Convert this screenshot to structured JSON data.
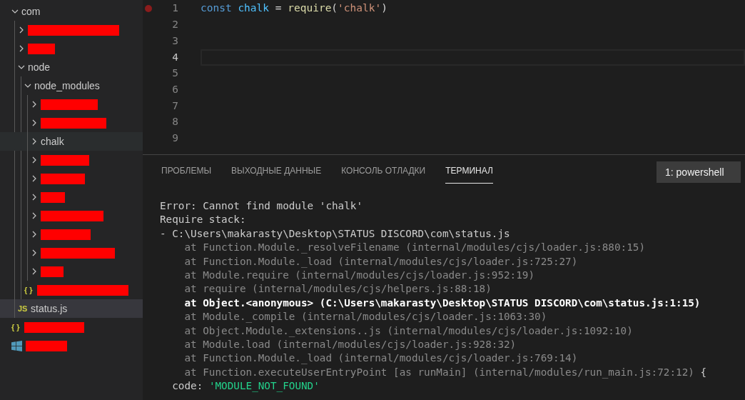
{
  "explorer": {
    "items": [
      {
        "kind": "folder",
        "label": "com",
        "expanded": true,
        "children": [
          {
            "kind": "folder",
            "redacted": true,
            "expanded": false
          },
          {
            "kind": "folder",
            "redacted": true,
            "expanded": false
          },
          {
            "kind": "folder",
            "label": "node",
            "expanded": true,
            "children": [
              {
                "kind": "folder",
                "label": "node_modules",
                "expanded": true,
                "children": [
                  {
                    "kind": "folder",
                    "redacted": true,
                    "expanded": false
                  },
                  {
                    "kind": "folder",
                    "redacted": true,
                    "expanded": false
                  },
                  {
                    "kind": "folder",
                    "label": "chalk",
                    "expanded": false,
                    "hovered": true
                  },
                  {
                    "kind": "folder",
                    "redacted": true,
                    "expanded": false
                  },
                  {
                    "kind": "folder",
                    "redacted": true,
                    "expanded": false
                  },
                  {
                    "kind": "folder",
                    "redacted": true,
                    "expanded": false
                  },
                  {
                    "kind": "folder",
                    "redacted": true,
                    "expanded": false
                  },
                  {
                    "kind": "folder",
                    "redacted": true,
                    "expanded": false
                  },
                  {
                    "kind": "folder",
                    "redacted": true,
                    "expanded": false
                  },
                  {
                    "kind": "folder",
                    "redacted": true,
                    "expanded": false
                  }
                ]
              },
              {
                "kind": "json",
                "badge": "{ }",
                "redacted": true
              }
            ]
          },
          {
            "kind": "js",
            "badge": "JS",
            "label": "status.js",
            "selected": true
          }
        ]
      },
      {
        "kind": "json",
        "badge": "{ }",
        "redacted": true
      },
      {
        "kind": "windows",
        "redacted": true
      }
    ]
  },
  "editor": {
    "lines": [
      {
        "number": "1",
        "breakpoint": true,
        "current": false,
        "tokens": [
          {
            "text": "const ",
            "kind": "keyword"
          },
          {
            "text": "chalk",
            "kind": "variable"
          },
          {
            "text": " = ",
            "kind": "plain"
          },
          {
            "text": "require",
            "kind": "function"
          },
          {
            "text": "(",
            "kind": "plain"
          },
          {
            "text": "'chalk'",
            "kind": "string"
          },
          {
            "text": ")",
            "kind": "plain"
          }
        ]
      },
      {
        "number": "2",
        "breakpoint": false,
        "current": false
      },
      {
        "number": "3",
        "breakpoint": false,
        "current": false
      },
      {
        "number": "4",
        "breakpoint": false,
        "current": true
      },
      {
        "number": "5",
        "breakpoint": false,
        "current": false
      },
      {
        "number": "6",
        "breakpoint": false,
        "current": false
      },
      {
        "number": "7",
        "breakpoint": false,
        "current": false
      },
      {
        "number": "8",
        "breakpoint": false,
        "current": false
      },
      {
        "number": "9",
        "breakpoint": false,
        "current": false
      }
    ]
  },
  "panel": {
    "tabs": [
      {
        "label": "ПРОБЛЕМЫ",
        "selected": false
      },
      {
        "label": "ВЫХОДНЫЕ ДАННЫЕ",
        "selected": false
      },
      {
        "label": "КОНСОЛЬ ОТЛАДКИ",
        "selected": false
      },
      {
        "label": "ТЕРМИНАЛ",
        "selected": true
      }
    ],
    "terminal_select": "1: powershell",
    "terminal": [
      {
        "kind": "normal",
        "text": "Error: Cannot find module 'chalk'"
      },
      {
        "kind": "normal",
        "text": "Require stack:"
      },
      {
        "kind": "normal",
        "text": "- C:\\Users\\makarasty\\Desktop\\STATUS DISCORD\\com\\status.js"
      },
      {
        "kind": "dim",
        "text": "    at Function.Module._resolveFilename (internal/modules/cjs/loader.js:880:15)"
      },
      {
        "kind": "dim",
        "text": "    at Function.Module._load (internal/modules/cjs/loader.js:725:27)"
      },
      {
        "kind": "dim",
        "text": "    at Module.require (internal/modules/cjs/loader.js:952:19)"
      },
      {
        "kind": "dim",
        "text": "    at require (internal/modules/cjs/helpers.js:88:18)"
      },
      {
        "kind": "bright",
        "text": "    at Object.<anonymous> (C:\\Users\\makarasty\\Desktop\\STATUS DISCORD\\com\\status.js:1:15)"
      },
      {
        "kind": "dim",
        "text": "    at Module._compile (internal/modules/cjs/loader.js:1063:30)"
      },
      {
        "kind": "dim",
        "text": "    at Object.Module._extensions..js (internal/modules/cjs/loader.js:1092:10)"
      },
      {
        "kind": "dim",
        "text": "    at Module.load (internal/modules/cjs/loader.js:928:32)"
      },
      {
        "kind": "dim",
        "text": "    at Function.Module._load (internal/modules/cjs/loader.js:769:14)"
      },
      {
        "kind": "mixed",
        "parts": [
          {
            "kind": "dim",
            "text": "    at Function.executeUserEntryPoint [as runMain] (internal/modules/run_main.js:72:12) "
          },
          {
            "kind": "normal",
            "text": "{"
          }
        ]
      },
      {
        "kind": "mixed",
        "parts": [
          {
            "kind": "normal",
            "text": "  code: "
          },
          {
            "kind": "string",
            "text": "'MODULE_NOT_FOUND'"
          }
        ]
      }
    ]
  }
}
